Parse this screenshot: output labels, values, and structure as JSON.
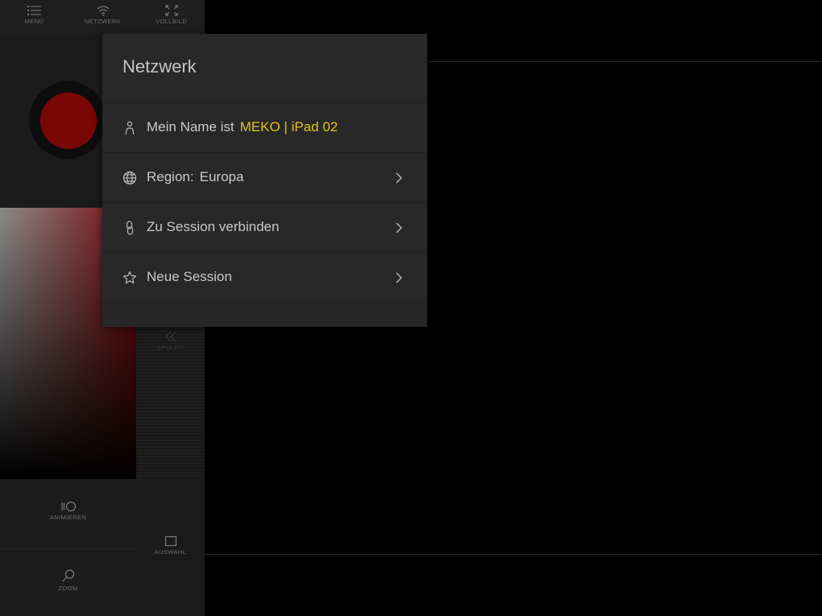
{
  "toolbar": {
    "items": [
      {
        "label": "MENÜ",
        "icon": "list-icon"
      },
      {
        "label": "NETZWERK",
        "icon": "wifi-icon"
      },
      {
        "label": "VOLLBILD",
        "icon": "fullscreen-icon"
      }
    ]
  },
  "side": {
    "spulen_label": "SPULEN",
    "animieren_label": "ANIMIEREN",
    "zoom_label": "ZOOM",
    "auswahl_label": "AUSWAHL",
    "color_swatch": "#7a0606"
  },
  "popover": {
    "title": "Netzwerk",
    "name_row": {
      "label": "Mein Name ist",
      "value": "MEKO | iPad 02",
      "icon": "person-icon"
    },
    "region_row": {
      "label": "Region:",
      "value": "Europa",
      "icon": "globe-icon"
    },
    "connect_row": {
      "label": "Zu Session verbinden",
      "icon": "link-icon"
    },
    "new_row": {
      "label": "Neue Session",
      "icon": "star-icon"
    }
  },
  "colors": {
    "accent": "#e4c11a",
    "background": "#000000",
    "panel": "#262626"
  }
}
